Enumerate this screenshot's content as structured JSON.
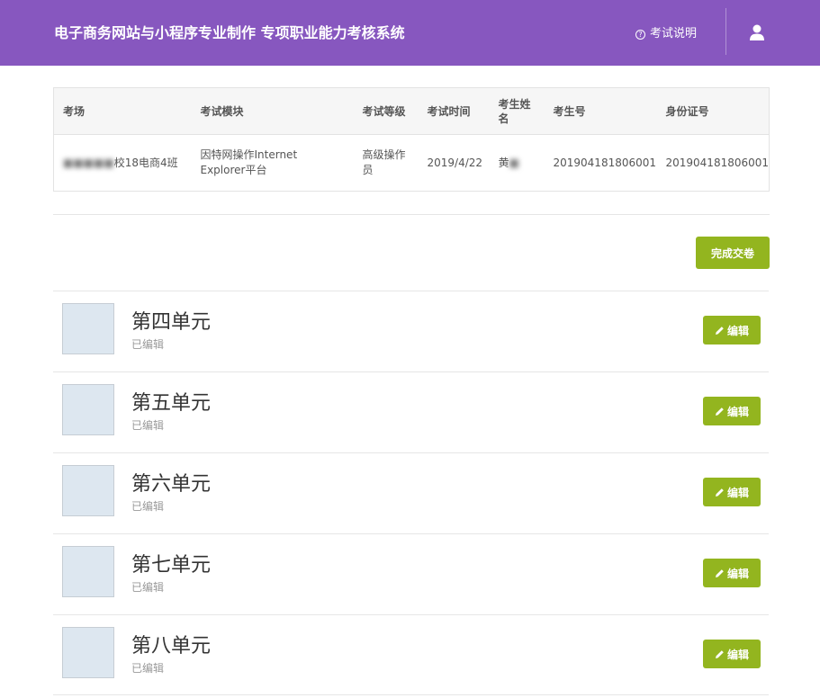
{
  "header": {
    "title": "电子商务网站与小程序专业制作 专项职业能力考核系统",
    "help_icon": "question-circle-icon",
    "help_label": "考试说明",
    "user_icon": "user-icon"
  },
  "exam_info": {
    "columns": [
      "考场",
      "考试模块",
      "考试等级",
      "考试时间",
      "考生姓名",
      "考生号",
      "身份证号"
    ],
    "row": {
      "venue": "校18电商4班",
      "module": "因特网操作Internet Explorer平台",
      "level": "高级操作员",
      "date": "2019/4/22",
      "name": "黄",
      "candidate_no": "201904181806001",
      "id_no": "201904181806001"
    }
  },
  "submit_label": "完成交卷",
  "units": [
    {
      "title": "第四单元",
      "status": "已编辑",
      "edit_label": "编辑"
    },
    {
      "title": "第五单元",
      "status": "已编辑",
      "edit_label": "编辑"
    },
    {
      "title": "第六单元",
      "status": "已编辑",
      "edit_label": "编辑"
    },
    {
      "title": "第七单元",
      "status": "已编辑",
      "edit_label": "编辑"
    },
    {
      "title": "第八单元",
      "status": "已编辑",
      "edit_label": "编辑"
    }
  ],
  "colors": {
    "header_bg": "#8757bf",
    "accent_green": "#93b51f",
    "thumb_bg": "#dde7f0"
  }
}
